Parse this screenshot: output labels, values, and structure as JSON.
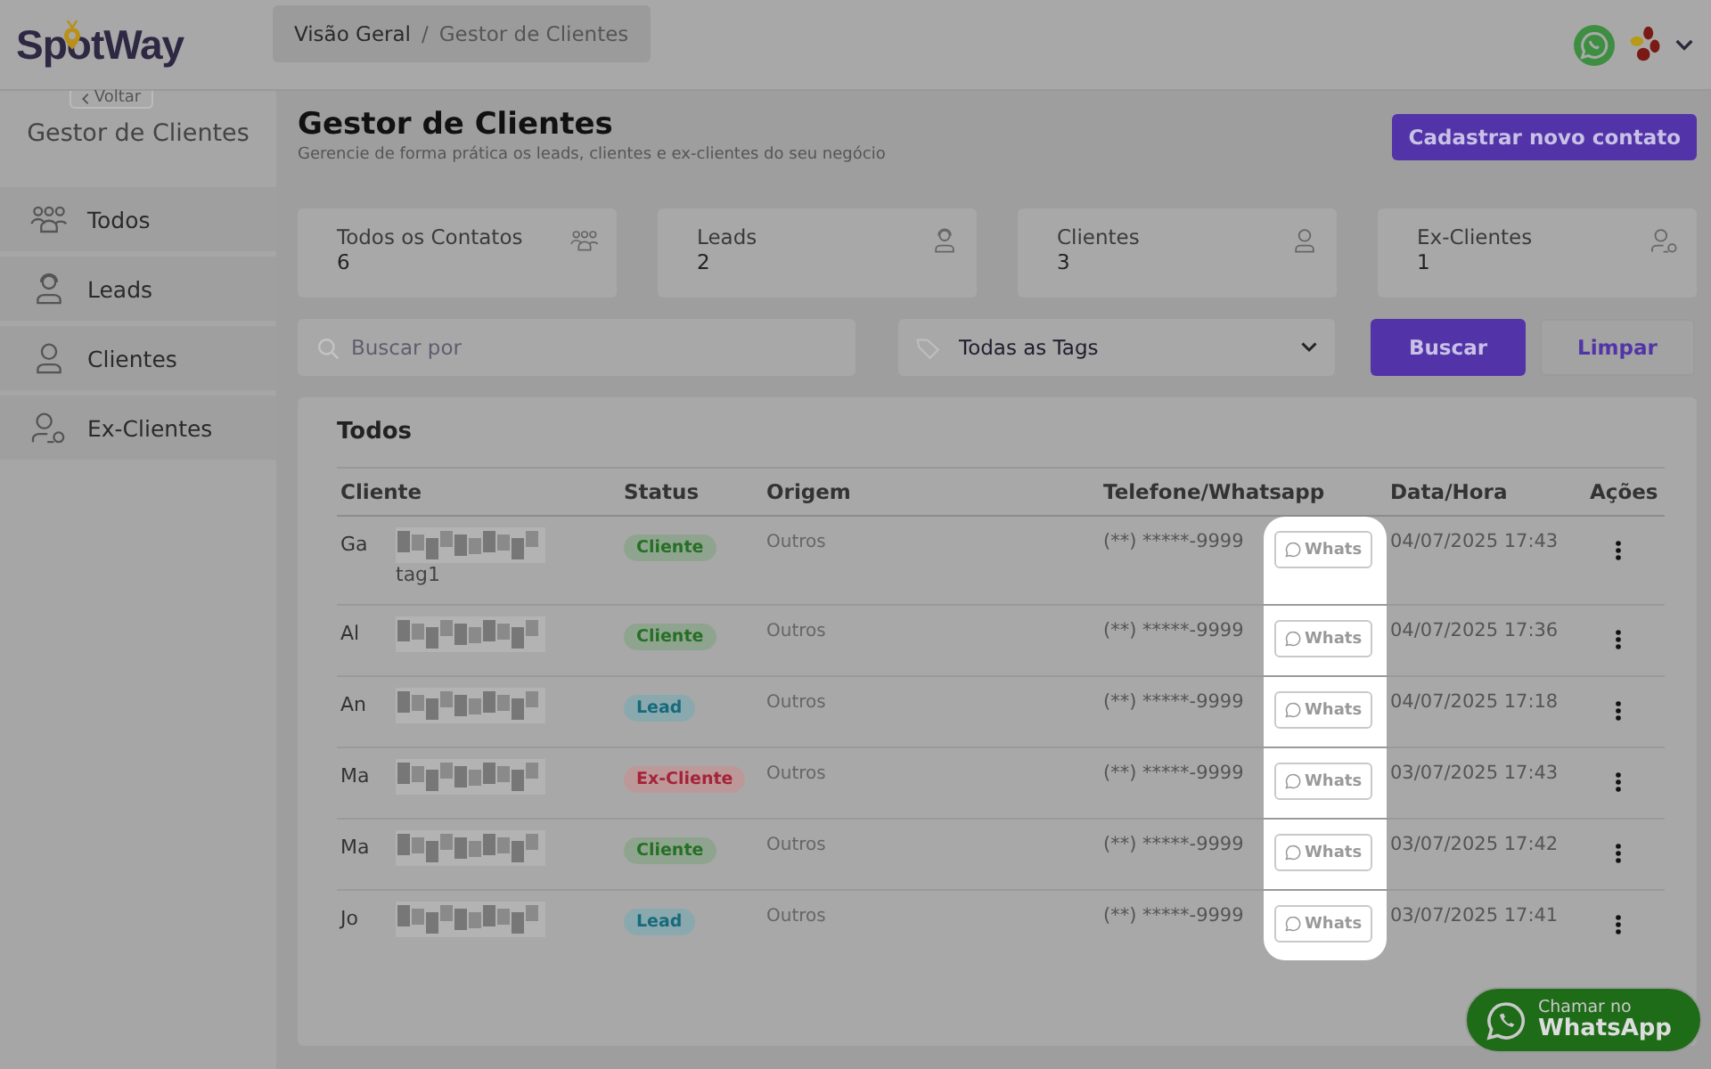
{
  "header": {
    "logo": "SpotWay",
    "breadcrumb_separator": "/",
    "breadcrumb": [
      {
        "label": "Visão Geral"
      },
      {
        "label": "Gestor de Clientes"
      }
    ]
  },
  "sidebar": {
    "back_button": "Voltar",
    "title": "Gestor de Clientes",
    "items": [
      {
        "label": "Todos"
      },
      {
        "label": "Leads"
      },
      {
        "label": "Clientes"
      },
      {
        "label": "Ex-Clientes"
      }
    ]
  },
  "page": {
    "title": "Gestor de Clientes",
    "subtitle": "Gerencie de forma prática os leads, clientes e ex-clientes do seu negócio",
    "new_button": "Cadastrar novo contato"
  },
  "stats": [
    {
      "label": "Todos os Contatos",
      "value": "6"
    },
    {
      "label": "Leads",
      "value": "2"
    },
    {
      "label": "Clientes",
      "value": "3"
    },
    {
      "label": "Ex-Clientes",
      "value": "1"
    }
  ],
  "filters": {
    "search": {
      "placeholder": "Buscar por"
    },
    "tags": {
      "value": "Todas as Tags"
    },
    "search_button": "Buscar",
    "clear_button": "Limpar"
  },
  "table": {
    "title": "Todos",
    "spotlight_whats": true,
    "columns": [
      "Cliente",
      "Status",
      "Origem",
      "Telefone/Whatsapp",
      "Data/Hora",
      "Ações"
    ],
    "rows": [
      {
        "client": "Ga",
        "tag": "tag1",
        "status": {
          "label": "Cliente",
          "kind": "cliente"
        },
        "origin": "Outros",
        "phone": "(**) *****-9999",
        "whats": "Whats",
        "date": "04/07/2025 17:43"
      },
      {
        "client": "Al",
        "status": {
          "label": "Cliente",
          "kind": "cliente"
        },
        "origin": "Outros",
        "phone": "(**) *****-9999",
        "whats": "Whats",
        "date": "04/07/2025 17:36"
      },
      {
        "client": "An",
        "status": {
          "label": "Lead",
          "kind": "lead"
        },
        "origin": "Outros",
        "phone": "(**) *****-9999",
        "whats": "Whats",
        "date": "04/07/2025 17:18"
      },
      {
        "client": "Ma",
        "status": {
          "label": "Ex-Cliente",
          "kind": "ex"
        },
        "origin": "Outros",
        "phone": "(**) *****-9999",
        "whats": "Whats",
        "date": "03/07/2025 17:43"
      },
      {
        "client": "Ma",
        "status": {
          "label": "Cliente",
          "kind": "cliente"
        },
        "origin": "Outros",
        "phone": "(**) *****-9999",
        "whats": "Whats",
        "date": "03/07/2025 17:42"
      },
      {
        "client": "Jo",
        "status": {
          "label": "Lead",
          "kind": "lead"
        },
        "origin": "Outros",
        "phone": "(**) *****-9999",
        "whats": "Whats",
        "date": "03/07/2025 17:41"
      }
    ]
  },
  "chat_button": {
    "line1": "Chamar no",
    "line2": "WhatsApp"
  }
}
